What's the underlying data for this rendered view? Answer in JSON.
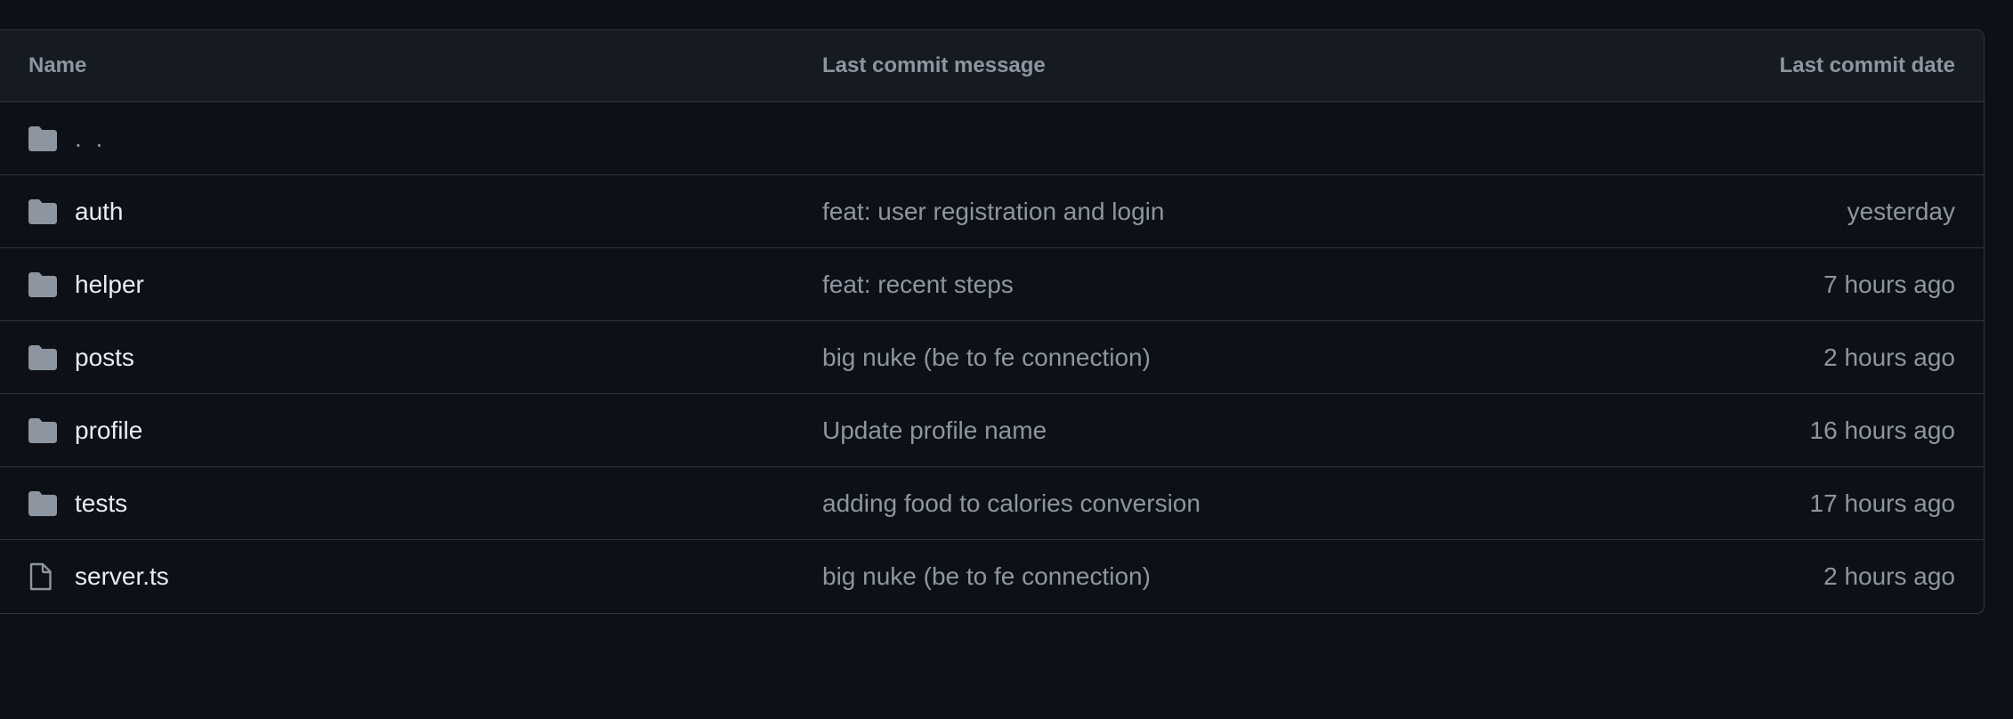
{
  "colors": {
    "background": "#0d1117",
    "header_bg": "#161b22",
    "border": "#30363d",
    "muted_text": "#8d96a0",
    "primary_text": "#e6edf3",
    "folder_icon": "#8d96a0"
  },
  "table": {
    "headers": {
      "name": "Name",
      "message": "Last commit message",
      "date": "Last commit date"
    },
    "parent": {
      "name": ". .",
      "icon": "folder-icon"
    },
    "rows": [
      {
        "name": "auth",
        "icon": "folder-icon",
        "message": "feat: user registration and login",
        "date": "yesterday"
      },
      {
        "name": "helper",
        "icon": "folder-icon",
        "message": "feat: recent steps",
        "date": "7 hours ago"
      },
      {
        "name": "posts",
        "icon": "folder-icon",
        "message": "big nuke (be to fe connection)",
        "date": "2 hours ago"
      },
      {
        "name": "profile",
        "icon": "folder-icon",
        "message": "Update profile name",
        "date": "16 hours ago"
      },
      {
        "name": "tests",
        "icon": "folder-icon",
        "message": "adding food to calories conversion",
        "date": "17 hours ago"
      },
      {
        "name": "server.ts",
        "icon": "file-icon",
        "message": "big nuke (be to fe connection)",
        "date": "2 hours ago"
      }
    ]
  }
}
